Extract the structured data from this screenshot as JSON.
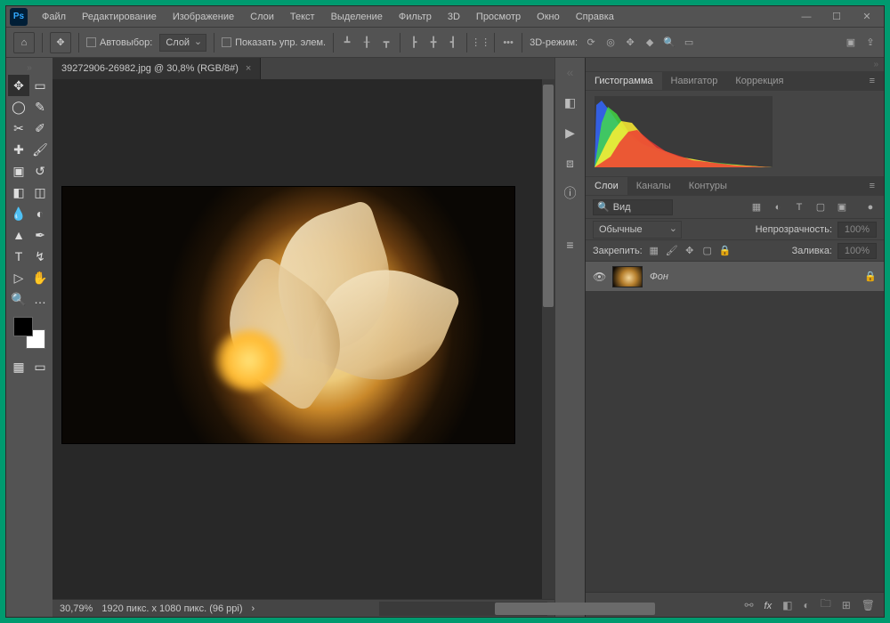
{
  "menu": [
    "Файл",
    "Редактирование",
    "Изображение",
    "Слои",
    "Текст",
    "Выделение",
    "Фильтр",
    "3D",
    "Просмотр",
    "Окно",
    "Справка"
  ],
  "optbar": {
    "autoselect": "Автовыбор:",
    "target": "Слой",
    "showcontrols": "Показать упр. элем.",
    "mode3d": "3D-режим:"
  },
  "doc": {
    "tab": "39272906-26982.jpg @ 30,8% (RGB/8#)",
    "zoom": "30,79%",
    "dims": "1920 пикс. x 1080 пикс. (96 ppi)"
  },
  "panels": {
    "hist_tabs": [
      "Гистограмма",
      "Навигатор",
      "Коррекция"
    ],
    "layer_tabs": [
      "Слои",
      "Каналы",
      "Контуры"
    ],
    "view_label": "Вид",
    "blend": "Обычные",
    "opacity_lbl": "Непрозрачность:",
    "opacity_val": "100%",
    "lock_lbl": "Закрепить:",
    "fill_lbl": "Заливка:",
    "fill_val": "100%",
    "layer_name": "Фон"
  }
}
